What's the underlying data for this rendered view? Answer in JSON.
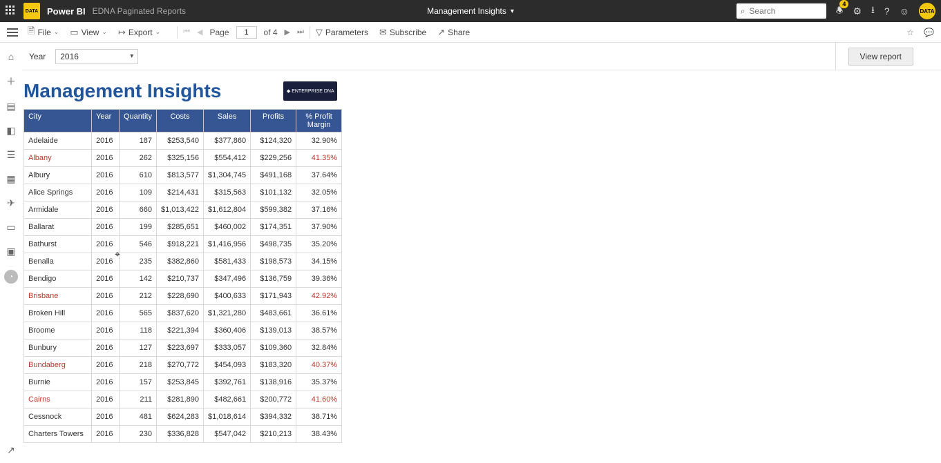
{
  "topbar": {
    "brand": "Power BI",
    "workspace": "EDNA Paginated Reports",
    "center": "Management Insights",
    "search_placeholder": "Search",
    "badge": "4",
    "logo": "DATA",
    "avatar": "DATA"
  },
  "secbar": {
    "file": "File",
    "view": "View",
    "export": "Export",
    "page_label": "Page",
    "page_current": "1",
    "page_of": "of 4",
    "parameters": "Parameters",
    "subscribe": "Subscribe",
    "share": "Share"
  },
  "params": {
    "label": "Year",
    "value": "2016",
    "view_btn": "View report"
  },
  "report": {
    "title": "Management Insights",
    "logo_text": "◆ ENTERPRISE DNA",
    "columns": [
      "City",
      "Year",
      "Quantity",
      "Costs",
      "Sales",
      "Profits",
      "% Profit Margin"
    ],
    "rows": [
      {
        "city": "Adelaide",
        "year": "2016",
        "qty": "187",
        "costs": "$253,540",
        "sales": "$377,860",
        "profits": "$124,320",
        "margin": "32.90%",
        "hl": false
      },
      {
        "city": "Albany",
        "year": "2016",
        "qty": "262",
        "costs": "$325,156",
        "sales": "$554,412",
        "profits": "$229,256",
        "margin": "41.35%",
        "hl": true
      },
      {
        "city": "Albury",
        "year": "2016",
        "qty": "610",
        "costs": "$813,577",
        "sales": "$1,304,745",
        "profits": "$491,168",
        "margin": "37.64%",
        "hl": false
      },
      {
        "city": "Alice Springs",
        "year": "2016",
        "qty": "109",
        "costs": "$214,431",
        "sales": "$315,563",
        "profits": "$101,132",
        "margin": "32.05%",
        "hl": false
      },
      {
        "city": "Armidale",
        "year": "2016",
        "qty": "660",
        "costs": "$1,013,422",
        "sales": "$1,612,804",
        "profits": "$599,382",
        "margin": "37.16%",
        "hl": false
      },
      {
        "city": "Ballarat",
        "year": "2016",
        "qty": "199",
        "costs": "$285,651",
        "sales": "$460,002",
        "profits": "$174,351",
        "margin": "37.90%",
        "hl": false
      },
      {
        "city": "Bathurst",
        "year": "2016",
        "qty": "546",
        "costs": "$918,221",
        "sales": "$1,416,956",
        "profits": "$498,735",
        "margin": "35.20%",
        "hl": false
      },
      {
        "city": "Benalla",
        "year": "2016",
        "qty": "235",
        "costs": "$382,860",
        "sales": "$581,433",
        "profits": "$198,573",
        "margin": "34.15%",
        "hl": false
      },
      {
        "city": "Bendigo",
        "year": "2016",
        "qty": "142",
        "costs": "$210,737",
        "sales": "$347,496",
        "profits": "$136,759",
        "margin": "39.36%",
        "hl": false
      },
      {
        "city": "Brisbane",
        "year": "2016",
        "qty": "212",
        "costs": "$228,690",
        "sales": "$400,633",
        "profits": "$171,943",
        "margin": "42.92%",
        "hl": true
      },
      {
        "city": "Broken Hill",
        "year": "2016",
        "qty": "565",
        "costs": "$837,620",
        "sales": "$1,321,280",
        "profits": "$483,661",
        "margin": "36.61%",
        "hl": false
      },
      {
        "city": "Broome",
        "year": "2016",
        "qty": "118",
        "costs": "$221,394",
        "sales": "$360,406",
        "profits": "$139,013",
        "margin": "38.57%",
        "hl": false
      },
      {
        "city": "Bunbury",
        "year": "2016",
        "qty": "127",
        "costs": "$223,697",
        "sales": "$333,057",
        "profits": "$109,360",
        "margin": "32.84%",
        "hl": false
      },
      {
        "city": "Bundaberg",
        "year": "2016",
        "qty": "218",
        "costs": "$270,772",
        "sales": "$454,093",
        "profits": "$183,320",
        "margin": "40.37%",
        "hl": true
      },
      {
        "city": "Burnie",
        "year": "2016",
        "qty": "157",
        "costs": "$253,845",
        "sales": "$392,761",
        "profits": "$138,916",
        "margin": "35.37%",
        "hl": false
      },
      {
        "city": "Cairns",
        "year": "2016",
        "qty": "211",
        "costs": "$281,890",
        "sales": "$482,661",
        "profits": "$200,772",
        "margin": "41.60%",
        "hl": true
      },
      {
        "city": "Cessnock",
        "year": "2016",
        "qty": "481",
        "costs": "$624,283",
        "sales": "$1,018,614",
        "profits": "$394,332",
        "margin": "38.71%",
        "hl": false
      },
      {
        "city": "Charters Towers",
        "year": "2016",
        "qty": "230",
        "costs": "$336,828",
        "sales": "$547,042",
        "profits": "$210,213",
        "margin": "38.43%",
        "hl": false
      }
    ]
  },
  "chart_data": {
    "type": "table",
    "title": "Management Insights",
    "columns": [
      "City",
      "Year",
      "Quantity",
      "Costs",
      "Sales",
      "Profits",
      "% Profit Margin"
    ],
    "rows": [
      [
        "Adelaide",
        2016,
        187,
        253540,
        377860,
        124320,
        32.9
      ],
      [
        "Albany",
        2016,
        262,
        325156,
        554412,
        229256,
        41.35
      ],
      [
        "Albury",
        2016,
        610,
        813577,
        1304745,
        491168,
        37.64
      ],
      [
        "Alice Springs",
        2016,
        109,
        214431,
        315563,
        101132,
        32.05
      ],
      [
        "Armidale",
        2016,
        660,
        1013422,
        1612804,
        599382,
        37.16
      ],
      [
        "Ballarat",
        2016,
        199,
        285651,
        460002,
        174351,
        37.9
      ],
      [
        "Bathurst",
        2016,
        546,
        918221,
        1416956,
        498735,
        35.2
      ],
      [
        "Benalla",
        2016,
        235,
        382860,
        581433,
        198573,
        34.15
      ],
      [
        "Bendigo",
        2016,
        142,
        210737,
        347496,
        136759,
        39.36
      ],
      [
        "Brisbane",
        2016,
        212,
        228690,
        400633,
        171943,
        42.92
      ],
      [
        "Broken Hill",
        2016,
        565,
        837620,
        1321280,
        483661,
        36.61
      ],
      [
        "Broome",
        2016,
        118,
        221394,
        360406,
        139013,
        38.57
      ],
      [
        "Bunbury",
        2016,
        127,
        223697,
        333057,
        109360,
        32.84
      ],
      [
        "Bundaberg",
        2016,
        218,
        270772,
        454093,
        183320,
        40.37
      ],
      [
        "Burnie",
        2016,
        157,
        253845,
        392761,
        138916,
        35.37
      ],
      [
        "Cairns",
        2016,
        211,
        281890,
        482661,
        200772,
        41.6
      ],
      [
        "Cessnock",
        2016,
        481,
        624283,
        1018614,
        394332,
        38.71
      ],
      [
        "Charters Towers",
        2016,
        230,
        336828,
        547042,
        210213,
        38.43
      ]
    ]
  }
}
